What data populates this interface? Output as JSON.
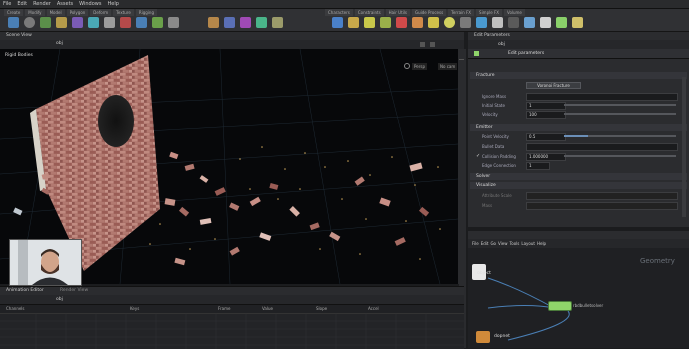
{
  "window": {
    "menu": [
      "File",
      "Edit",
      "Render",
      "Assets",
      "Windows",
      "Help"
    ],
    "shelf_tabs": [
      "Create",
      "Modify",
      "Model",
      "Polygon",
      "Deform",
      "Texture",
      "Rigging",
      "Characters",
      "Constraints",
      "Hair Utils",
      "Guide Process",
      "Terrain FX",
      "Simple FX",
      "Volume"
    ]
  },
  "viewport": {
    "pane_title": "Scene View",
    "label": "Rigid Bodies",
    "persp": "Persp",
    "camera": "No cam"
  },
  "params": {
    "title": "Edit Parameters",
    "node_name": "Edit parameters",
    "sections": [
      "Fracture",
      "Emitter",
      "Solver",
      "Visualize"
    ],
    "field_labels": [
      "Ignore Mass",
      "Initial State",
      "Velocity",
      "Point Velocity",
      "Bullet Data",
      "Collision Padding",
      "Edge Connection",
      "Attribute Scale",
      "Mass"
    ],
    "values": [
      "1",
      "100",
      "0.5",
      "1",
      "1.000000"
    ],
    "fracture_button": "Voronoi Fracture"
  },
  "network": {
    "path": "obj",
    "context_label": "Geometry",
    "node_label": "rbdbulletsolver",
    "top_node_label": "object",
    "bottom_node_label": "dopnet",
    "menu": [
      "File",
      "Edit",
      "Go",
      "View",
      "Tools",
      "Layout",
      "Help"
    ]
  },
  "timeline": {
    "tabs": [
      "Animation Editor",
      "Render View"
    ],
    "labels": [
      "Channels",
      "Keys",
      "Frame",
      "Value",
      "Slope",
      "Accel"
    ]
  },
  "colors": {
    "accent_green": "#8fd46a",
    "bg_dark": "#07080a",
    "panel": "#2b2c2f"
  }
}
